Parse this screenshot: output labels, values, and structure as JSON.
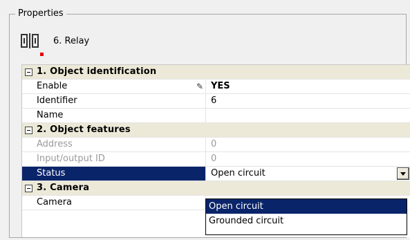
{
  "group": {
    "title": "Properties"
  },
  "object": {
    "title": "6. Relay",
    "icon": "relay-icon"
  },
  "categories": [
    {
      "label": "1. Object identification"
    },
    {
      "label": "2. Object features"
    },
    {
      "label": "3. Camera"
    }
  ],
  "properties": {
    "enable": {
      "label": "Enable",
      "value": "YES"
    },
    "identifier": {
      "label": "Identifier",
      "value": "6"
    },
    "name": {
      "label": "Name",
      "value": ""
    },
    "address": {
      "label": "Address",
      "value": "0"
    },
    "io_id": {
      "label": "Input/output ID",
      "value": "0"
    },
    "status": {
      "label": "Status",
      "value": "Open circuit"
    },
    "camera": {
      "label": "Camera",
      "value": ""
    }
  },
  "dropdown": {
    "options": [
      "Open circuit",
      "Grounded circuit"
    ],
    "selected": "Open circuit"
  },
  "colors": {
    "selection": "#0a246a",
    "category_bg": "#ece9d8",
    "indicator": "#e60000"
  }
}
